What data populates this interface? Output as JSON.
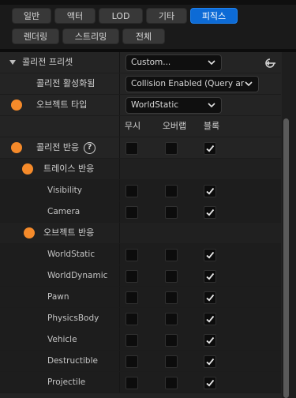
{
  "filter_tabs": {
    "row1": [
      {
        "label": "일반",
        "active": false
      },
      {
        "label": "액터",
        "active": false
      },
      {
        "label": "LOD",
        "active": false
      },
      {
        "label": "기타",
        "active": false
      },
      {
        "label": "피직스",
        "active": true
      }
    ],
    "row2": [
      {
        "label": "렌더링",
        "active": false
      },
      {
        "label": "스트리밍",
        "active": false
      },
      {
        "label": "전체",
        "active": false
      }
    ]
  },
  "collision_presets": {
    "label": "콜리전 프리셋",
    "value": "Custom..."
  },
  "collision_enabled": {
    "label": "콜리전 활성화됨",
    "value": "Collision Enabled (Query ar"
  },
  "object_type": {
    "label": "오브젝트 타입",
    "value": "WorldStatic"
  },
  "response_headers": {
    "ignore": "무시",
    "overlap": "오버랩",
    "block": "블록"
  },
  "collision_responses": {
    "label": "콜리전 반응",
    "help_icon": "?",
    "block_checked": true
  },
  "trace_responses": {
    "label": "트레이스 반응",
    "items": [
      {
        "name": "Visibility",
        "ignore": false,
        "overlap": false,
        "block": true
      },
      {
        "name": "Camera",
        "ignore": false,
        "overlap": false,
        "block": true
      }
    ]
  },
  "object_responses": {
    "label": "오브젝트 반응",
    "items": [
      {
        "name": "WorldStatic",
        "ignore": false,
        "overlap": false,
        "block": true
      },
      {
        "name": "WorldDynamic",
        "ignore": false,
        "overlap": false,
        "block": true
      },
      {
        "name": "Pawn",
        "ignore": false,
        "overlap": false,
        "block": true
      },
      {
        "name": "PhysicsBody",
        "ignore": false,
        "overlap": false,
        "block": true
      },
      {
        "name": "Vehicle",
        "ignore": false,
        "overlap": false,
        "block": true
      },
      {
        "name": "Destructible",
        "ignore": false,
        "overlap": false,
        "block": true
      },
      {
        "name": "Projectile",
        "ignore": false,
        "overlap": false,
        "block": true
      }
    ]
  },
  "colors": {
    "accent": "#0d6bd6",
    "marker": "#f58a2a",
    "panel": "#242424"
  },
  "icons": {
    "reset": "reset-arrow-icon",
    "expand": "expand-triangle-icon",
    "dropdown": "chevron-down-icon",
    "check": "checkmark-icon"
  }
}
